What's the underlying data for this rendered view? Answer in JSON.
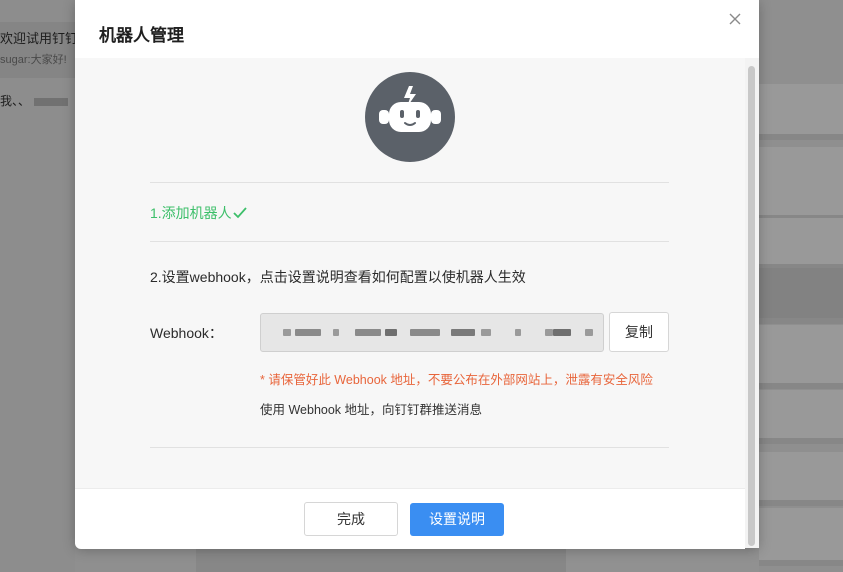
{
  "background": {
    "chat": {
      "title": "欢迎试用钉钉",
      "preview": "sugar:大家好!",
      "line": "我、、"
    }
  },
  "dialog": {
    "title": "机器人管理",
    "close_icon": "close-icon",
    "avatar_icon": "robot-icon",
    "step1": "1.添加机器人",
    "step1_check_icon": "checkmark-icon",
    "step2": "2.设置webhook，点击设置说明查看如何配置以使机器人生效",
    "webhook_label": "Webhook：",
    "webhook_value_masked": true,
    "copy_label": "复制",
    "warning": "* 请保管好此 Webhook 地址，不要公布在外部网站上，泄露有安全风险",
    "hint": "使用 Webhook 地址，向钉钉群推送消息",
    "done_label": "完成",
    "help_label": "设置说明"
  },
  "colors": {
    "success_green": "#3dbf6a",
    "warning_orange": "#e8653b",
    "primary_blue": "#3a8ef2",
    "avatar_bg": "#5b6169"
  }
}
